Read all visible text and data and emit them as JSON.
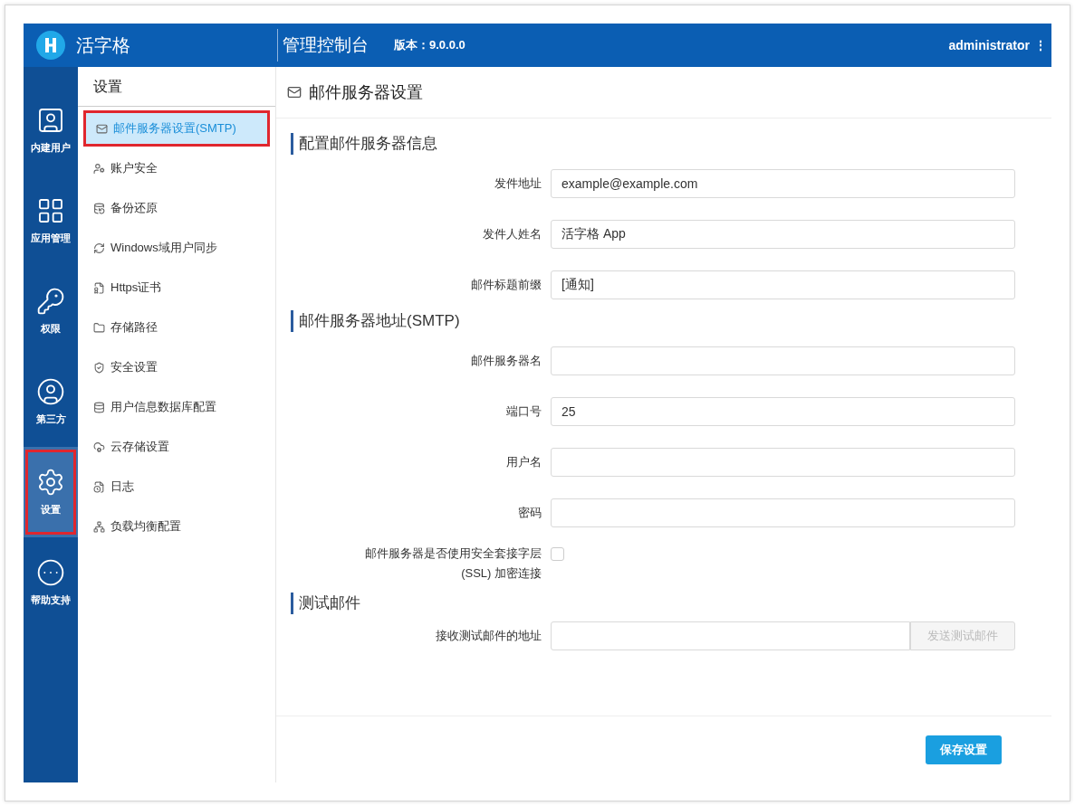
{
  "header": {
    "logo_name": "活字格",
    "console_title": "管理控制台",
    "version": "版本：9.0.0.0",
    "user": "administrator",
    "menu_glyph": "⋮"
  },
  "rail": [
    {
      "label": "内建用户",
      "kind": "users",
      "selected": false,
      "annotated": false
    },
    {
      "label": "应用管理",
      "kind": "apps",
      "selected": false,
      "annotated": false
    },
    {
      "label": "权限",
      "kind": "permissions",
      "selected": false,
      "annotated": false
    },
    {
      "label": "第三方",
      "kind": "thirdparty",
      "selected": false,
      "annotated": false
    },
    {
      "label": "设置",
      "kind": "settings",
      "selected": true,
      "annotated": true
    },
    {
      "label": "帮助支持",
      "kind": "help",
      "selected": false,
      "annotated": false
    }
  ],
  "menu": {
    "title": "设置",
    "items": [
      {
        "label": "邮件服务器设置(SMTP)",
        "kind": "mail",
        "selected": true,
        "annotated": true
      },
      {
        "label": "账户安全",
        "kind": "account",
        "selected": false,
        "annotated": false
      },
      {
        "label": "备份还原",
        "kind": "backup",
        "selected": false,
        "annotated": false
      },
      {
        "label": "Windows域用户同步",
        "kind": "sync",
        "selected": false,
        "annotated": false
      },
      {
        "label": "Https证书",
        "kind": "certificate",
        "selected": false,
        "annotated": false
      },
      {
        "label": "存储路径",
        "kind": "storage",
        "selected": false,
        "annotated": false
      },
      {
        "label": "安全设置",
        "kind": "security",
        "selected": false,
        "annotated": false
      },
      {
        "label": "用户信息数据库配置",
        "kind": "database",
        "selected": false,
        "annotated": false
      },
      {
        "label": "云存储设置",
        "kind": "cloud",
        "selected": false,
        "annotated": false
      },
      {
        "label": "日志",
        "kind": "log",
        "selected": false,
        "annotated": false
      },
      {
        "label": "负载均衡配置",
        "kind": "balance",
        "selected": false,
        "annotated": false
      }
    ]
  },
  "page": {
    "title": "邮件服务器设置",
    "sections": [
      {
        "title": "配置邮件服务器信息",
        "fields": [
          {
            "kind": "text",
            "label": "发件地址",
            "value": "example@example.com"
          },
          {
            "kind": "text",
            "label": "发件人姓名",
            "value": "活字格 App"
          },
          {
            "kind": "text",
            "label": "邮件标题前缀",
            "value": "[通知]"
          }
        ]
      },
      {
        "title": "邮件服务器地址(SMTP)",
        "fields": [
          {
            "kind": "text",
            "label": "邮件服务器名"
          },
          {
            "kind": "text",
            "label": "端口号",
            "value": "25"
          },
          {
            "kind": "text",
            "label": "用户名"
          },
          {
            "kind": "password",
            "label": "密码"
          },
          {
            "kind": "checkbox",
            "label_lines": [
              "邮件服务器是否使用安全套接字层",
              "(SSL) 加密连接"
            ],
            "checked": false
          }
        ]
      },
      {
        "title": "测试邮件",
        "fields": [
          {
            "kind": "send",
            "label": "接收测试邮件的地址",
            "button": "发送测试邮件",
            "disabled": true
          }
        ]
      }
    ],
    "save_button": "保存设置"
  }
}
